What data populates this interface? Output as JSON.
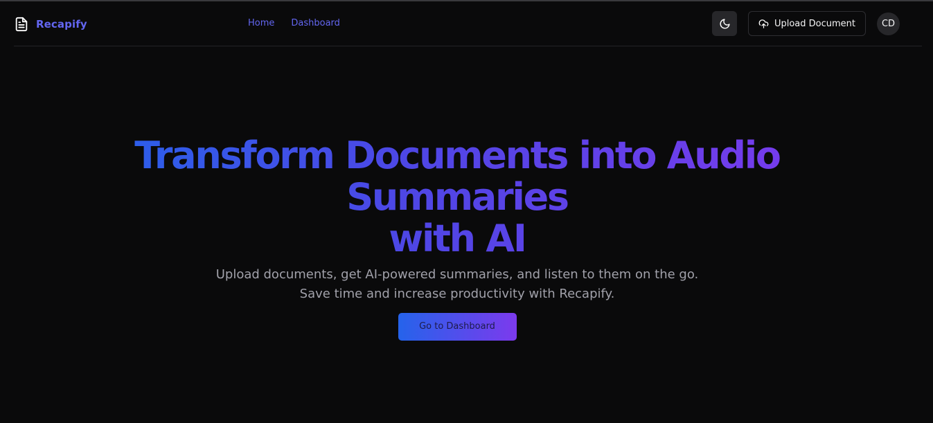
{
  "header": {
    "brand_name": "Recapify",
    "brand_icon": "document-icon",
    "nav": [
      {
        "label": "Home"
      },
      {
        "label": "Dashboard"
      }
    ],
    "theme_toggle_icon": "moon-icon",
    "upload_button": {
      "label": "Upload Document",
      "icon": "cloud-upload-icon"
    },
    "avatar_initials": "CD"
  },
  "hero": {
    "title_line1": "Transform Documents into Audio Summaries",
    "title_line2": "with AI",
    "subtitle_line1": "Upload documents, get AI-powered summaries, and listen to them on the go.",
    "subtitle_line2": "Save time and increase productivity with Recapify.",
    "cta_label": "Go to Dashboard"
  },
  "colors": {
    "background": "#0a0a0b",
    "accent": "#6366f1",
    "gradient_start": "#2563eb",
    "gradient_end": "#7c3aed",
    "muted_text": "#a1a1aa"
  }
}
